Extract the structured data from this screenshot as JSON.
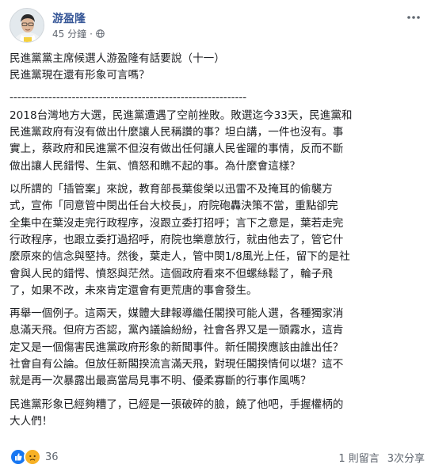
{
  "post": {
    "author": "游盈隆",
    "timestamp": "45 分鐘",
    "privacy_icon": "globe-icon",
    "intro_lines": [
      "民進黨黨主席候選人游盈隆有話要說（十一）",
      "民進黨現在還有形象可言嗎？"
    ],
    "divider": "-------------------------------------------------------------",
    "paragraphs": [
      [
        "2018台灣地方大選，民進黨遭遇了空前挫敗。敗選迄今33天，民進黨和",
        "民進黨政府有沒有做出什麼讓人民稱讚的事？坦白講，一件也沒有。事",
        "實上，蔡政府和民進黨不但沒有做出任何讓人民雀躍的事情，反而不斷",
        "做出讓人民錯愕、生氣、憤怒和瞧不起的事。為什麼會這樣？"
      ],
      [
        "以所謂的「插管案」來說，教育部長葉俊榮以迅雷不及掩耳的偷襲方",
        "式，宣佈「同意管中閔出任台大校長」，府院砲轟決策不當，重點卻完",
        "全集中在葉沒走完行政程序，沒跟立委打招呼；言下之意是，葉若走完",
        "行政程序，也跟立委打過招呼，府院也樂意放行，就由他去了，管它什",
        "麼原來的信念與堅持。然後，葉走人，管中閔1/8風光上任，留下的是社",
        "會與人民的錯愕、憤怒與茫然。這個政府看來不但螺絲鬆了，輪子飛",
        "了，如果不改，未來肯定還會有更荒唐的事會發生。"
      ],
      [
        "再舉一個例子。這兩天，媒體大肆報導繼任閣揆可能人選，各種獨家消",
        "息滿天飛。但府方否認，黨內議論紛紛，社會各界又是一頭霧水，這肯",
        "定又是一個傷害民進黨政府形象的新聞事件。新任閣揆應該由誰出任？",
        "社會自有公論。但放任新閣揆流言滿天飛，對現任閣揆情何以堪？這不",
        "就是再一次暴露出最高當局見事不明、優柔寡斷的行事作風嗎？"
      ],
      [
        "民進黨形象已經夠糟了，已經是一張破碎的臉，饒了他吧，手握權柄的",
        "大人們！"
      ]
    ]
  },
  "footer": {
    "reaction_icons": [
      "like-icon",
      "sad-icon"
    ],
    "reaction_count": "36",
    "comments": "1 則留言",
    "shares": "3次分享"
  },
  "colors": {
    "author": "#385898",
    "like": "#1877f2",
    "sad": "#f7b125",
    "meta": "#616770"
  }
}
